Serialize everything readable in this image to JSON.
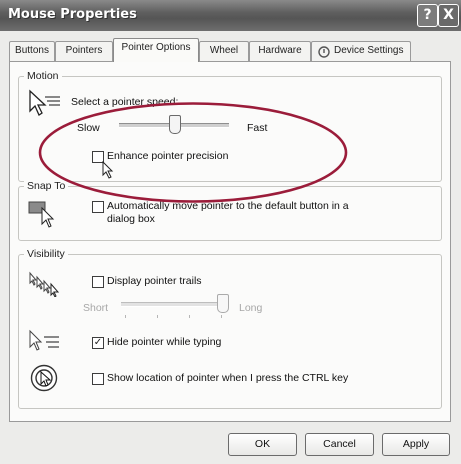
{
  "window": {
    "title": "Mouse Properties",
    "help_label": "?",
    "close_label": "X"
  },
  "tabs": [
    {
      "label": "Buttons",
      "active": false
    },
    {
      "label": "Pointers",
      "active": false
    },
    {
      "label": "Pointer Options",
      "active": true
    },
    {
      "label": "Wheel",
      "active": false
    },
    {
      "label": "Hardware",
      "active": false
    },
    {
      "label": "Device Settings",
      "active": false
    }
  ],
  "motion": {
    "legend": "Motion",
    "speed_prompt": "Select a pointer speed:",
    "slow_label": "Slow",
    "fast_label": "Fast",
    "speed_level": 0.5,
    "enhance_label": "Enhance pointer precision",
    "enhance_checked": false
  },
  "snap_to": {
    "legend": "Snap To",
    "auto_move_label": "Automatically move pointer to the default button in a",
    "auto_move_label_2": "dialog box",
    "checked": false
  },
  "visibility": {
    "legend": "Visibility",
    "trails_label": "Display pointer trails",
    "trails_checked": false,
    "short_label": "Short",
    "long_label": "Long",
    "trail_level": 1.0,
    "hide_label": "Hide pointer while typing",
    "hide_checked": true,
    "check_mark": "✓",
    "show_location_label": "Show location of pointer when I press the CTRL key",
    "show_location_checked": false
  },
  "buttons": {
    "ok": "OK",
    "cancel": "Cancel",
    "apply": "Apply"
  },
  "colors": {
    "annotation_circle": "#9b1c3a",
    "titlebar": "#5f5f5f"
  }
}
